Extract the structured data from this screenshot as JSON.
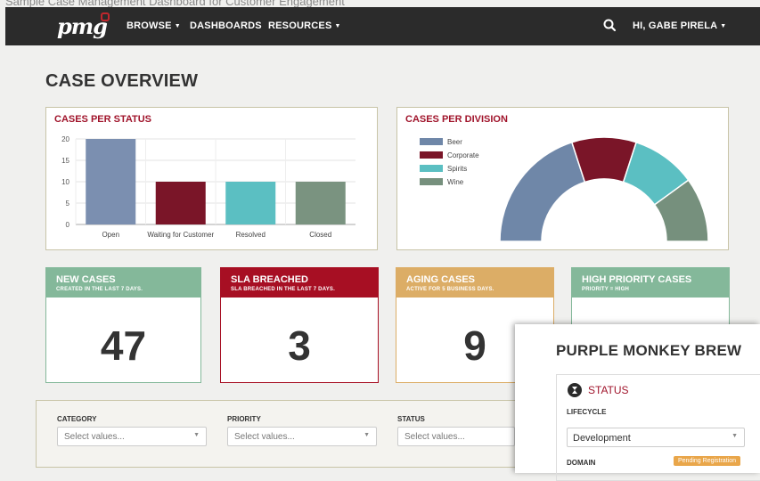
{
  "caption": "Sample Case Management Dashboard for Customer Engagement",
  "nav": {
    "logo": "pmg",
    "browse": "BROWSE",
    "dashboards": "DASHBOARDS",
    "resources": "RESOURCES",
    "user": "HI, GABE PIRELA",
    "search_icon": "search-icon"
  },
  "page_title": "CASE OVERVIEW",
  "status_chart": {
    "title": "CASES PER STATUS",
    "chart_data": {
      "type": "bar",
      "categories": [
        "Open",
        "Waiting for Customer",
        "Resolved",
        "Closed"
      ],
      "values": [
        20,
        10,
        10,
        10
      ],
      "ylim": [
        0,
        20
      ],
      "yticks": [
        "0",
        "5",
        "10",
        "15",
        "20"
      ],
      "colors": [
        "#7b8fb0",
        "#7a1528",
        "#5bbfc2",
        "#7a9380"
      ],
      "grid": true
    }
  },
  "division_chart": {
    "title": "CASES PER DIVISION",
    "chart_data": {
      "type": "pie",
      "categories": [
        "Beer",
        "Corporate",
        "Spirits",
        "Wine"
      ],
      "values": [
        40,
        20,
        20,
        20
      ],
      "colors": [
        "#6f87a8",
        "#7a1528",
        "#5bbfc2",
        "#76907d"
      ],
      "legend": "top-left"
    }
  },
  "stats": [
    {
      "title": "NEW CASES",
      "sub": "CREATED IN THE LAST 7 DAYS.",
      "value": "47",
      "color": "#84b89a"
    },
    {
      "title": "SLA BREACHED",
      "sub": "SLA BREACHED IN THE LAST 7 DAYS.",
      "value": "3",
      "color": "#a70f23"
    },
    {
      "title": "AGING CASES",
      "sub": "ACTIVE FOR 5 BUSINESS DAYS.",
      "value": "9",
      "color": "#dcad66"
    },
    {
      "title": "HIGH PRIORITY CASES",
      "sub": "PRIORITY = HIGH",
      "value": "",
      "color": "#84b89a"
    }
  ],
  "filters": {
    "category": {
      "label": "CATEGORY",
      "placeholder": "Select values..."
    },
    "priority": {
      "label": "PRIORITY",
      "placeholder": "Select values..."
    },
    "status": {
      "label": "STATUS",
      "placeholder": "Select values..."
    }
  },
  "overlay": {
    "title": "PURPLE MONKEY BREW",
    "status_heading": "STATUS",
    "lifecycle_label": "LIFECYCLE",
    "lifecycle_value": "Development",
    "domain_label": "DOMAIN",
    "domain_badge": "Pending Registration"
  }
}
